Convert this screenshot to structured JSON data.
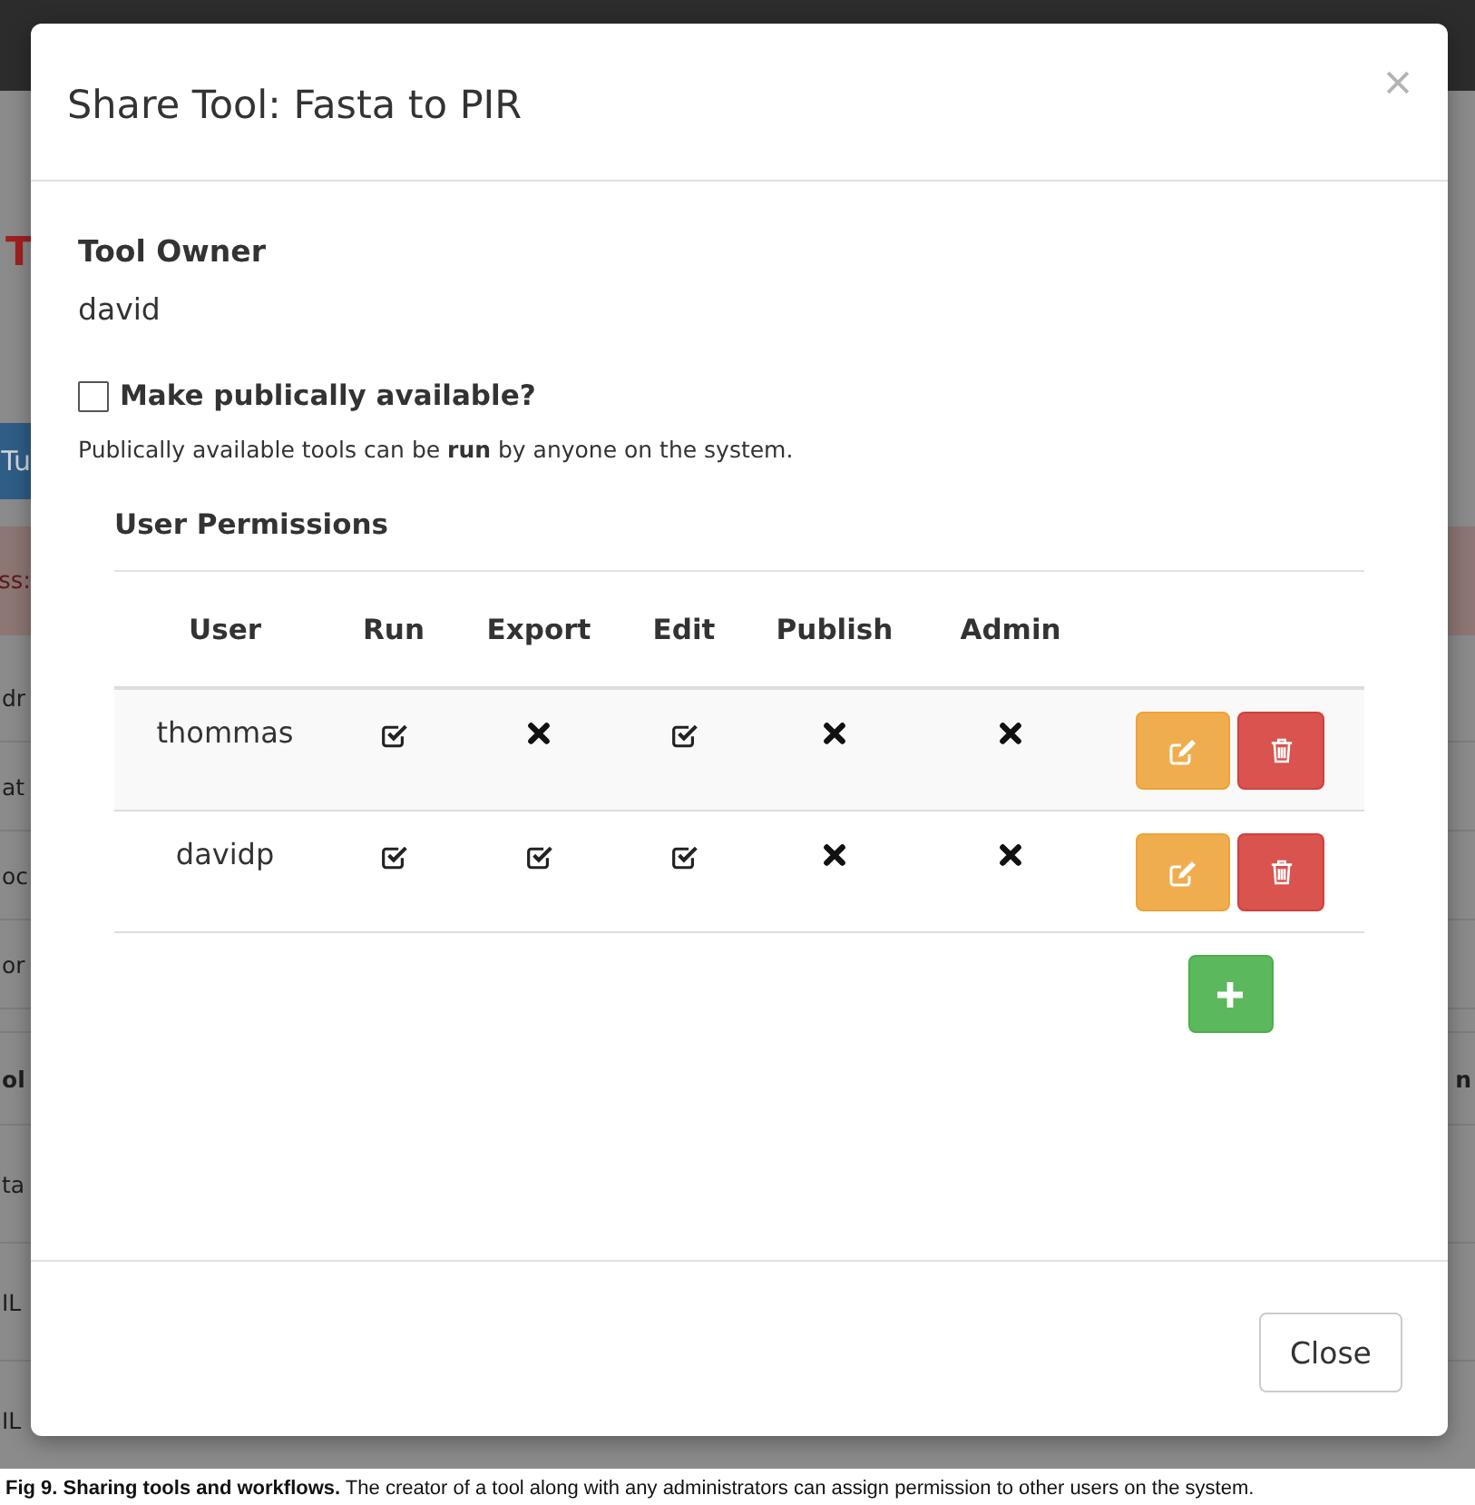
{
  "background_page": {
    "logo_fragment": "T",
    "button_fragment": "Tu",
    "alert_fragment": "ss:",
    "list_rows": [
      "dr",
      "at",
      "oc",
      "or"
    ],
    "table_header": {
      "left": "ol",
      "right": "n"
    },
    "table_rows": [
      "ta",
      "IL",
      "IL"
    ]
  },
  "dialog": {
    "title": "Share Tool: Fasta to PIR",
    "owner_label": "Tool Owner",
    "owner": "david",
    "public_checkbox": {
      "label": "Make publically available?",
      "checked": false
    },
    "public_help": "Publically available tools can be **run** by anyone on the system.",
    "permissions_title": "User Permissions",
    "columns": [
      "User",
      "Run",
      "Export",
      "Edit",
      "Publish",
      "Admin"
    ],
    "rows": [
      {
        "user": "thommas",
        "permissions": [
          {
            "checked": true
          },
          {
            "checked": false
          },
          {
            "checked": true
          },
          {
            "checked": false
          },
          {
            "checked": false
          }
        ]
      },
      {
        "user": "davidp",
        "permissions": [
          {
            "checked": true
          },
          {
            "checked": true
          },
          {
            "checked": true
          },
          {
            "checked": false
          },
          {
            "checked": false
          }
        ]
      }
    ],
    "footer_button": "Close"
  },
  "caption": "**Fig 9. Sharing tools and workflows.** The creator of a tool along with any administrators can assign permission to other users on the system."
}
